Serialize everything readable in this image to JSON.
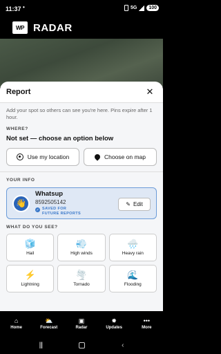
{
  "status_bar": {
    "time": "11:37",
    "dot": "•",
    "network": "5G",
    "battery": "100"
  },
  "header": {
    "logo_text": "WP",
    "title": "RADAR"
  },
  "sheet": {
    "title": "Report",
    "close_symbol": "✕",
    "intro": "Add your spot so others can see you're here. Pins expire after 1 hour.",
    "where_label": "WHERE?",
    "location_value": "Not set — choose an option below",
    "use_location_label": "Use my location",
    "choose_map_label": "Choose on map",
    "your_info_label": "YOUR INFO",
    "user": {
      "avatar_emoji": "👋",
      "name": "Whatsup",
      "phone": "8592505142",
      "saved_label": "SAVED FOR FUTURE REPORTS",
      "check_symbol": "✓",
      "edit_label": "Edit",
      "edit_symbol": "✎"
    },
    "what_label": "WHAT DO YOU SEE?",
    "options": [
      {
        "icon": "🧊",
        "label": "Hail",
        "icon_name": "hail-icon"
      },
      {
        "icon": "💨",
        "label": "High winds",
        "icon_name": "wind-icon"
      },
      {
        "icon": "🌧️",
        "label": "Heavy rain",
        "icon_name": "rain-icon"
      },
      {
        "icon": "⚡",
        "label": "Lightning",
        "icon_name": "lightning-icon"
      },
      {
        "icon": "🌪️",
        "label": "Tornado",
        "icon_name": "tornado-icon"
      },
      {
        "icon": "🌊",
        "label": "Flooding",
        "icon_name": "flood-icon"
      }
    ]
  },
  "bottom_nav": [
    {
      "icon": "⌂",
      "label": "Home"
    },
    {
      "icon": "⛅",
      "label": "Forecast"
    },
    {
      "icon": "▣",
      "label": "Radar"
    },
    {
      "icon": "✹",
      "label": "Updates"
    },
    {
      "icon": "•••",
      "label": "More"
    }
  ],
  "system_nav": {
    "recents": "|||",
    "back": "‹"
  },
  "colors": {
    "accent": "#3a78c9",
    "card_border": "#6b9bd8",
    "card_bg": "#dfe8f5"
  }
}
